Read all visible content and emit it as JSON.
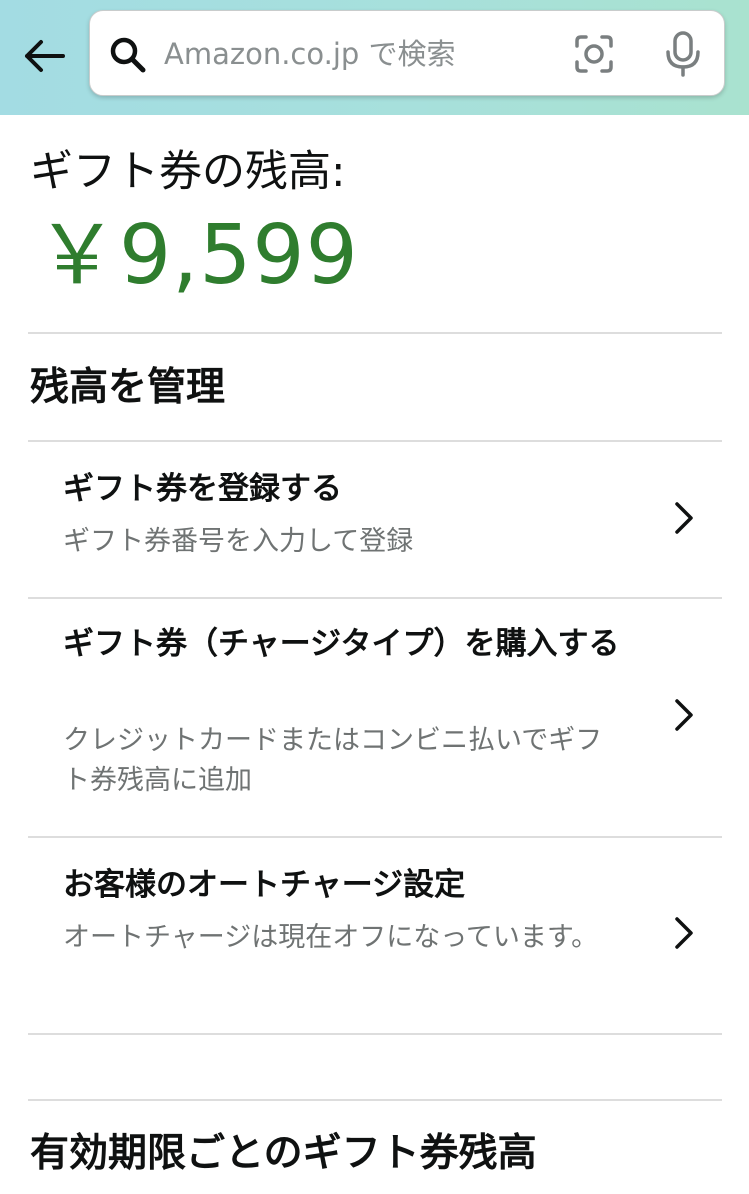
{
  "header": {
    "search_placeholder": "Amazon.co.jp で検索"
  },
  "balance": {
    "label": "ギフト券の残高:",
    "amount": "￥9,599"
  },
  "manage_section": {
    "title": "残高を管理",
    "items": [
      {
        "title": "ギフト券を登録する",
        "description": "ギフト券番号を入力して登録"
      },
      {
        "title": "ギフト券（チャージタイプ）を購入する",
        "description": "クレジットカードまたはコンビニ払いでギフト券残高に追加"
      },
      {
        "title": "お客様のオートチャージ設定",
        "description": "オートチャージは現在オフになっています。"
      }
    ]
  },
  "expiry_section": {
    "title": "有効期限ごとのギフト券残高"
  },
  "icons": {
    "back": "arrow-left-icon",
    "search": "search-icon",
    "camera": "camera-icon",
    "mic": "microphone-icon",
    "chevron": "chevron-right-icon"
  },
  "colors": {
    "balance_green": "#2f7d2e",
    "header_gradient_start": "#a3dce3",
    "header_gradient_end": "#a9e2cf",
    "secondary_text": "#6f7373"
  }
}
